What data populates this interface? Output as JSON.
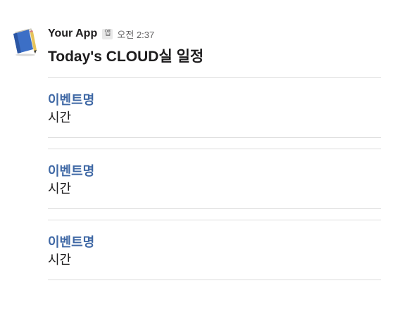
{
  "message": {
    "app_name": "Your App",
    "app_badge": "앱",
    "timestamp": "오전 2:37",
    "title": "Today's CLOUD실 일정",
    "avatar_icon": "notebook-icon"
  },
  "events": [
    {
      "name": "이벤트명",
      "time": "시간"
    },
    {
      "name": "이벤트명",
      "time": "시간"
    },
    {
      "name": "이벤트명",
      "time": "시간"
    }
  ],
  "colors": {
    "event_name": "#3f68a5",
    "divider": "#dddddd",
    "badge_bg": "#e8e8e8"
  }
}
